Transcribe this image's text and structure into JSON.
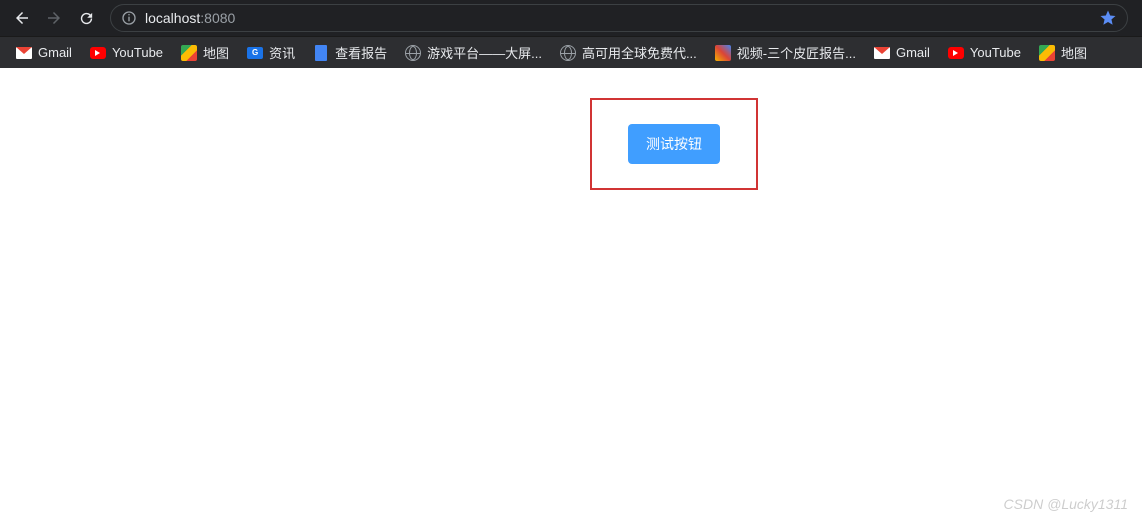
{
  "address": {
    "host_visible": "localhost",
    "port_visible": ":8080"
  },
  "bookmarks": [
    {
      "label": "Gmail",
      "icon": "gmail-icon"
    },
    {
      "label": "YouTube",
      "icon": "youtube-icon"
    },
    {
      "label": "地图",
      "icon": "map-icon"
    },
    {
      "label": "资讯",
      "icon": "news-icon"
    },
    {
      "label": "查看报告",
      "icon": "doc-icon"
    },
    {
      "label": "游戏平台——大屏...",
      "icon": "globe-icon"
    },
    {
      "label": "高可用全球免费代...",
      "icon": "globe-icon"
    },
    {
      "label": "视频-三个皮匠报告...",
      "icon": "img-icon"
    },
    {
      "label": "Gmail",
      "icon": "gmail-icon"
    },
    {
      "label": "YouTube",
      "icon": "youtube-icon"
    },
    {
      "label": "地图",
      "icon": "map-icon"
    }
  ],
  "content": {
    "test_button_label": "测试按钮",
    "highlight_border_color": "#d13434",
    "button_bg_color": "#409eff"
  },
  "watermark": "CSDN @Lucky1311"
}
